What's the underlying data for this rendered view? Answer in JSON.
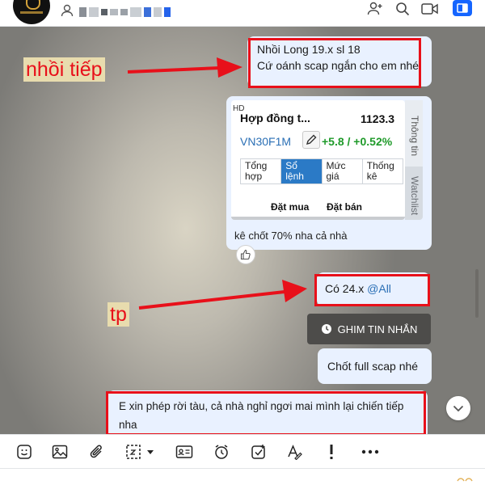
{
  "header": {
    "member_icon": "person-icon",
    "redacted_name_colors": [
      "#8a8f96",
      "#c7cbd0",
      "#5a6067",
      "#b4b9bf",
      "#9aa0a7",
      "#c9ced3",
      "#3b6fd9",
      "#2563eb",
      "#a4a9af"
    ],
    "actions": [
      "add-member-icon",
      "search-icon",
      "video-call-icon",
      "sidebar-toggle-icon"
    ],
    "accent": "#1565ff"
  },
  "messages": {
    "msg1": {
      "line1": "Nhồi Long 19.x sl 18",
      "line2": "Cứ oánh scap ngắn cho em nhé"
    },
    "card": {
      "hd": "HD",
      "contract_name": "Hợp đồng t...",
      "price": "1123.3",
      "code": "VN30F1M",
      "change": "+5.8 / +0.52%",
      "tabs": [
        {
          "l1": "Tổng",
          "l2": "hợp"
        },
        {
          "l1": "Sổ",
          "l2": "lệnh"
        },
        {
          "l1": "Mức",
          "l2": "giá"
        },
        {
          "l1": "Thống",
          "l2": "kê"
        }
      ],
      "active_tab": "Sổ lệnh",
      "col_buy": "Đặt mua",
      "col_sell": "Đặt bán",
      "side_tab_info": "Thông tin",
      "side_tab_watch": "Watchlist",
      "caption": "kê chốt 70% nha cả nhà"
    },
    "msg_co": {
      "text": "Có 24.x ",
      "mention": "@All"
    },
    "pin_label": "GHIM TIN NHẮN",
    "msg_chot": "Chốt full scap nhé",
    "msg_last": {
      "line1": "E xin phép rời tàu, cả nhà nghỉ ngơi mai mình lại chiến tiếp",
      "line2": "nha"
    }
  },
  "annotations": {
    "label_top": "nhồi tiếp",
    "label_mid": "tp",
    "color": "#e8101a"
  },
  "toolbar": {
    "icons": [
      "sticker-icon",
      "image-icon",
      "attachment-icon",
      "screenshot-icon",
      "contact-card-icon",
      "reminder-icon",
      "task-icon",
      "text-format-icon",
      "important-icon",
      "more-icon"
    ]
  }
}
